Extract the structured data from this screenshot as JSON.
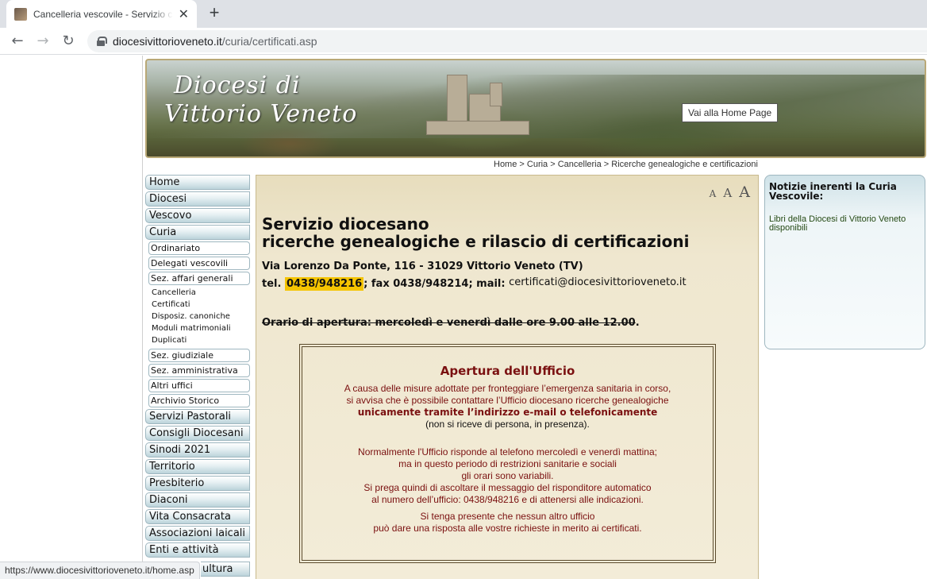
{
  "browser": {
    "tab_title": "Cancelleria vescovile - Servizio ce",
    "url_host": "diocesivittorioveneto.it",
    "url_path": "/curia/certificati.asp",
    "status_url": "https://www.diocesivittorioveneto.it/home.asp"
  },
  "banner": {
    "logo_line1": "Diocesi di",
    "logo_line2": "Vittorio Veneto",
    "home_link": "Vai alla Home Page"
  },
  "breadcrumb": "Home > Curia > Cancelleria > Ricerche genealogiche e certificazioni",
  "menu": {
    "top": [
      "Home",
      "Diocesi",
      "Vescovo",
      "Curia"
    ],
    "curia_sub_a": [
      "Ordinariato",
      "Delegati vescovili",
      "Sez. affari generali"
    ],
    "affari_sub": [
      "Cancelleria",
      "Certificati",
      "Disposiz. canoniche",
      "Moduli matrimoniali",
      "Duplicati"
    ],
    "curia_sub_b": [
      "Sez. giudiziale",
      "Sez. amministrativa",
      "Altri uffici",
      "Archivio Storico"
    ],
    "bottom": [
      "Servizi Pastorali",
      "Consigli Diocesani",
      "Sinodi 2021",
      "Territorio",
      "Presbiterio",
      "Diaconi",
      "Vita Consacrata",
      "Associazioni laicali",
      "Enti e attività"
    ],
    "partial": "ultura"
  },
  "content": {
    "font_sizes": [
      "A",
      "A",
      "A"
    ],
    "title_line1": "Servizio diocesano",
    "title_line2": "ricerche genealogiche e rilascio di certificazioni",
    "address": "Via Lorenzo Da Ponte, 116 - 31029 Vittorio Veneto (TV)",
    "tel_label": "tel.",
    "tel": "0438/948216",
    "fax_mail": "; fax 0438/948214; mail:",
    "email": "certificati@diocesivittorioveneto.it",
    "hours": "Orario di apertura: mercoledì e venerdì dalle ore 9.00 alle 12.00",
    "hours_end": "."
  },
  "notice": {
    "title": "Apertura dell'Ufficio",
    "p1_line1": "A causa delle misure adottate per fronteggiare l’emergenza sanitaria in corso,",
    "p1_line2": "si avvisa che è possibile contattare l’Ufficio diocesano ricerche genealogiche",
    "p1_bold": "unicamente tramite l’indirizzo e-mail o telefonicamente",
    "p1_line4": "(non si riceve di persona, in presenza).",
    "p2_line1": "Normalmente l'Ufficio risponde al telefono mercoledì e venerdì mattina;",
    "p2_line2": "ma in questo periodo di restrizioni sanitarie e sociali",
    "p2_line3": "gli orari sono variabili.",
    "p2_line4": "Si prega quindi di ascoltare il messaggio del risponditore automatico",
    "p2_line5": "al numero dell’ufficio: 0438/948216 e di attenersi alle indicazioni.",
    "p3_line1": "Si tenga presente che nessun altro ufficio",
    "p3_line2": "può dare una risposta alle vostre richieste in merito ai certificati."
  },
  "sidebar_right": {
    "title": "Notizie inerenti la Curia Vescovile:",
    "link": "Libri della Diocesi di Vittorio Veneto disponibili"
  }
}
